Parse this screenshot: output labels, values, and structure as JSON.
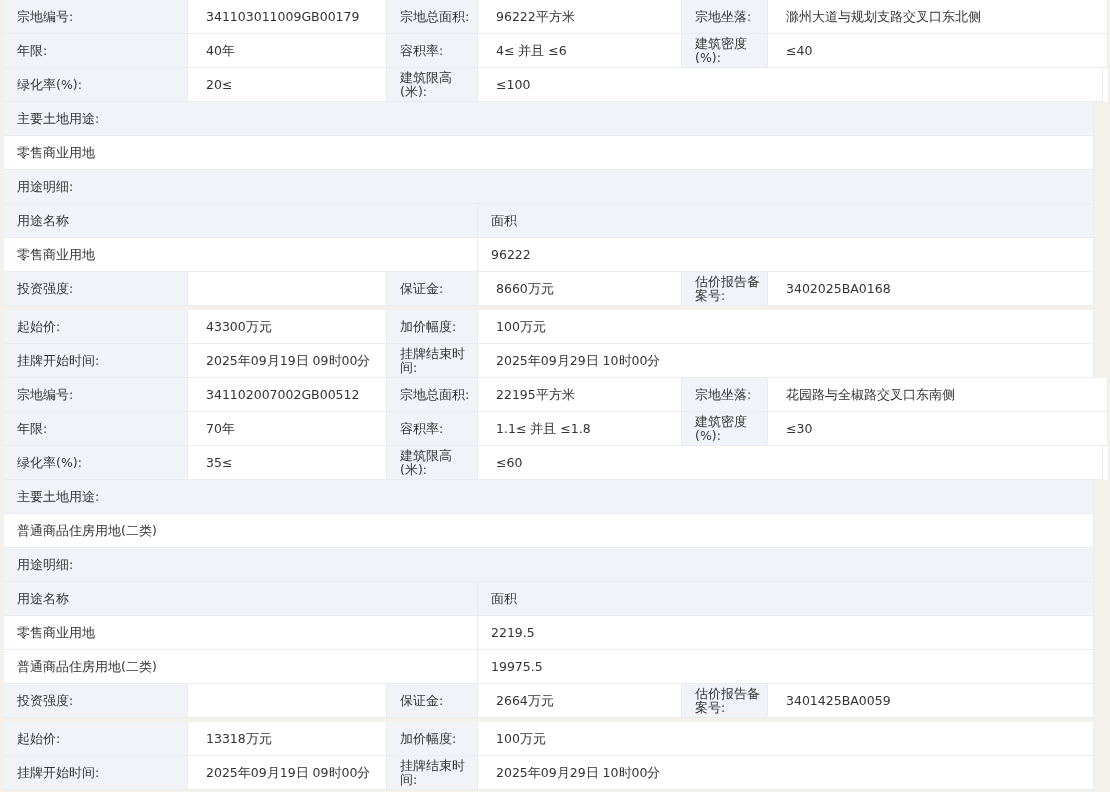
{
  "parcels": [
    {
      "fields": [
        [
          {
            "label": "宗地编号:",
            "value": "341103011009GB00179"
          },
          {
            "label": "宗地总面积:",
            "value": "96222平方米"
          },
          {
            "label": "宗地坐落:",
            "value": "滁州大道与规划支路交叉口东北侧"
          }
        ],
        [
          {
            "label": "年限:",
            "value": "40年"
          },
          {
            "label": "容积率:",
            "value": "4≤ 并且 ≤6"
          },
          {
            "label": "建筑密度(%):",
            "value": "≤40"
          }
        ],
        [
          {
            "label": "绿化率(%):",
            "value": "20≤"
          },
          {
            "label": "建筑限高(米):",
            "value": "≤100"
          }
        ]
      ],
      "main_use": {
        "label": "主要土地用途:",
        "value": "零售商业用地"
      },
      "use_detail": {
        "label": "用途明细:",
        "columns": [
          "用途名称",
          "面积"
        ],
        "rows": [
          [
            "零售商业用地",
            "96222"
          ]
        ]
      },
      "fees": [
        {
          "label": "投资强度:"
        },
        {
          "label": "保证金:",
          "value": "8660万元"
        },
        {
          "label": "估价报告备案号:",
          "value": "3402025BA0168"
        }
      ],
      "auction": [
        [
          {
            "label": "起始价:",
            "value": "43300万元"
          },
          {
            "label": "加价幅度:",
            "value": "100万元"
          }
        ],
        [
          {
            "label": "挂牌开始时间:",
            "value": "2025年09月19日 09时00分"
          },
          {
            "label": "挂牌结束时间:",
            "value": "2025年09月29日 10时00分"
          }
        ]
      ]
    },
    {
      "fields": [
        [
          {
            "label": "宗地编号:",
            "value": "341102007002GB00512"
          },
          {
            "label": "宗地总面积:",
            "value": "22195平方米"
          },
          {
            "label": "宗地坐落:",
            "value": "花园路与全椒路交叉口东南侧"
          }
        ],
        [
          {
            "label": "年限:",
            "value": "70年"
          },
          {
            "label": "容积率:",
            "value": "1.1≤ 并且 ≤1.8"
          },
          {
            "label": "建筑密度(%):",
            "value": "≤30"
          }
        ],
        [
          {
            "label": "绿化率(%):",
            "value": "35≤"
          },
          {
            "label": "建筑限高(米):",
            "value": "≤60"
          }
        ]
      ],
      "main_use": {
        "label": "主要土地用途:",
        "value": "普通商品住房用地(二类)"
      },
      "use_detail": {
        "label": "用途明细:",
        "columns": [
          "用途名称",
          "面积"
        ],
        "rows": [
          [
            "零售商业用地",
            "2219.5"
          ],
          [
            "普通商品住房用地(二类)",
            "19975.5"
          ]
        ]
      },
      "fees": [
        {
          "label": "投资强度:"
        },
        {
          "label": "保证金:",
          "value": "2664万元"
        },
        {
          "label": "估价报告备案号:",
          "value": "3401425BA0059"
        }
      ],
      "auction": [
        [
          {
            "label": "起始价:",
            "value": "13318万元"
          },
          {
            "label": "加价幅度:",
            "value": "100万元"
          }
        ],
        [
          {
            "label": "挂牌开始时间:",
            "value": "2025年09月19日 09时00分"
          },
          {
            "label": "挂牌结束时间:",
            "value": "2025年09月29日 10时00分"
          }
        ]
      ]
    }
  ]
}
